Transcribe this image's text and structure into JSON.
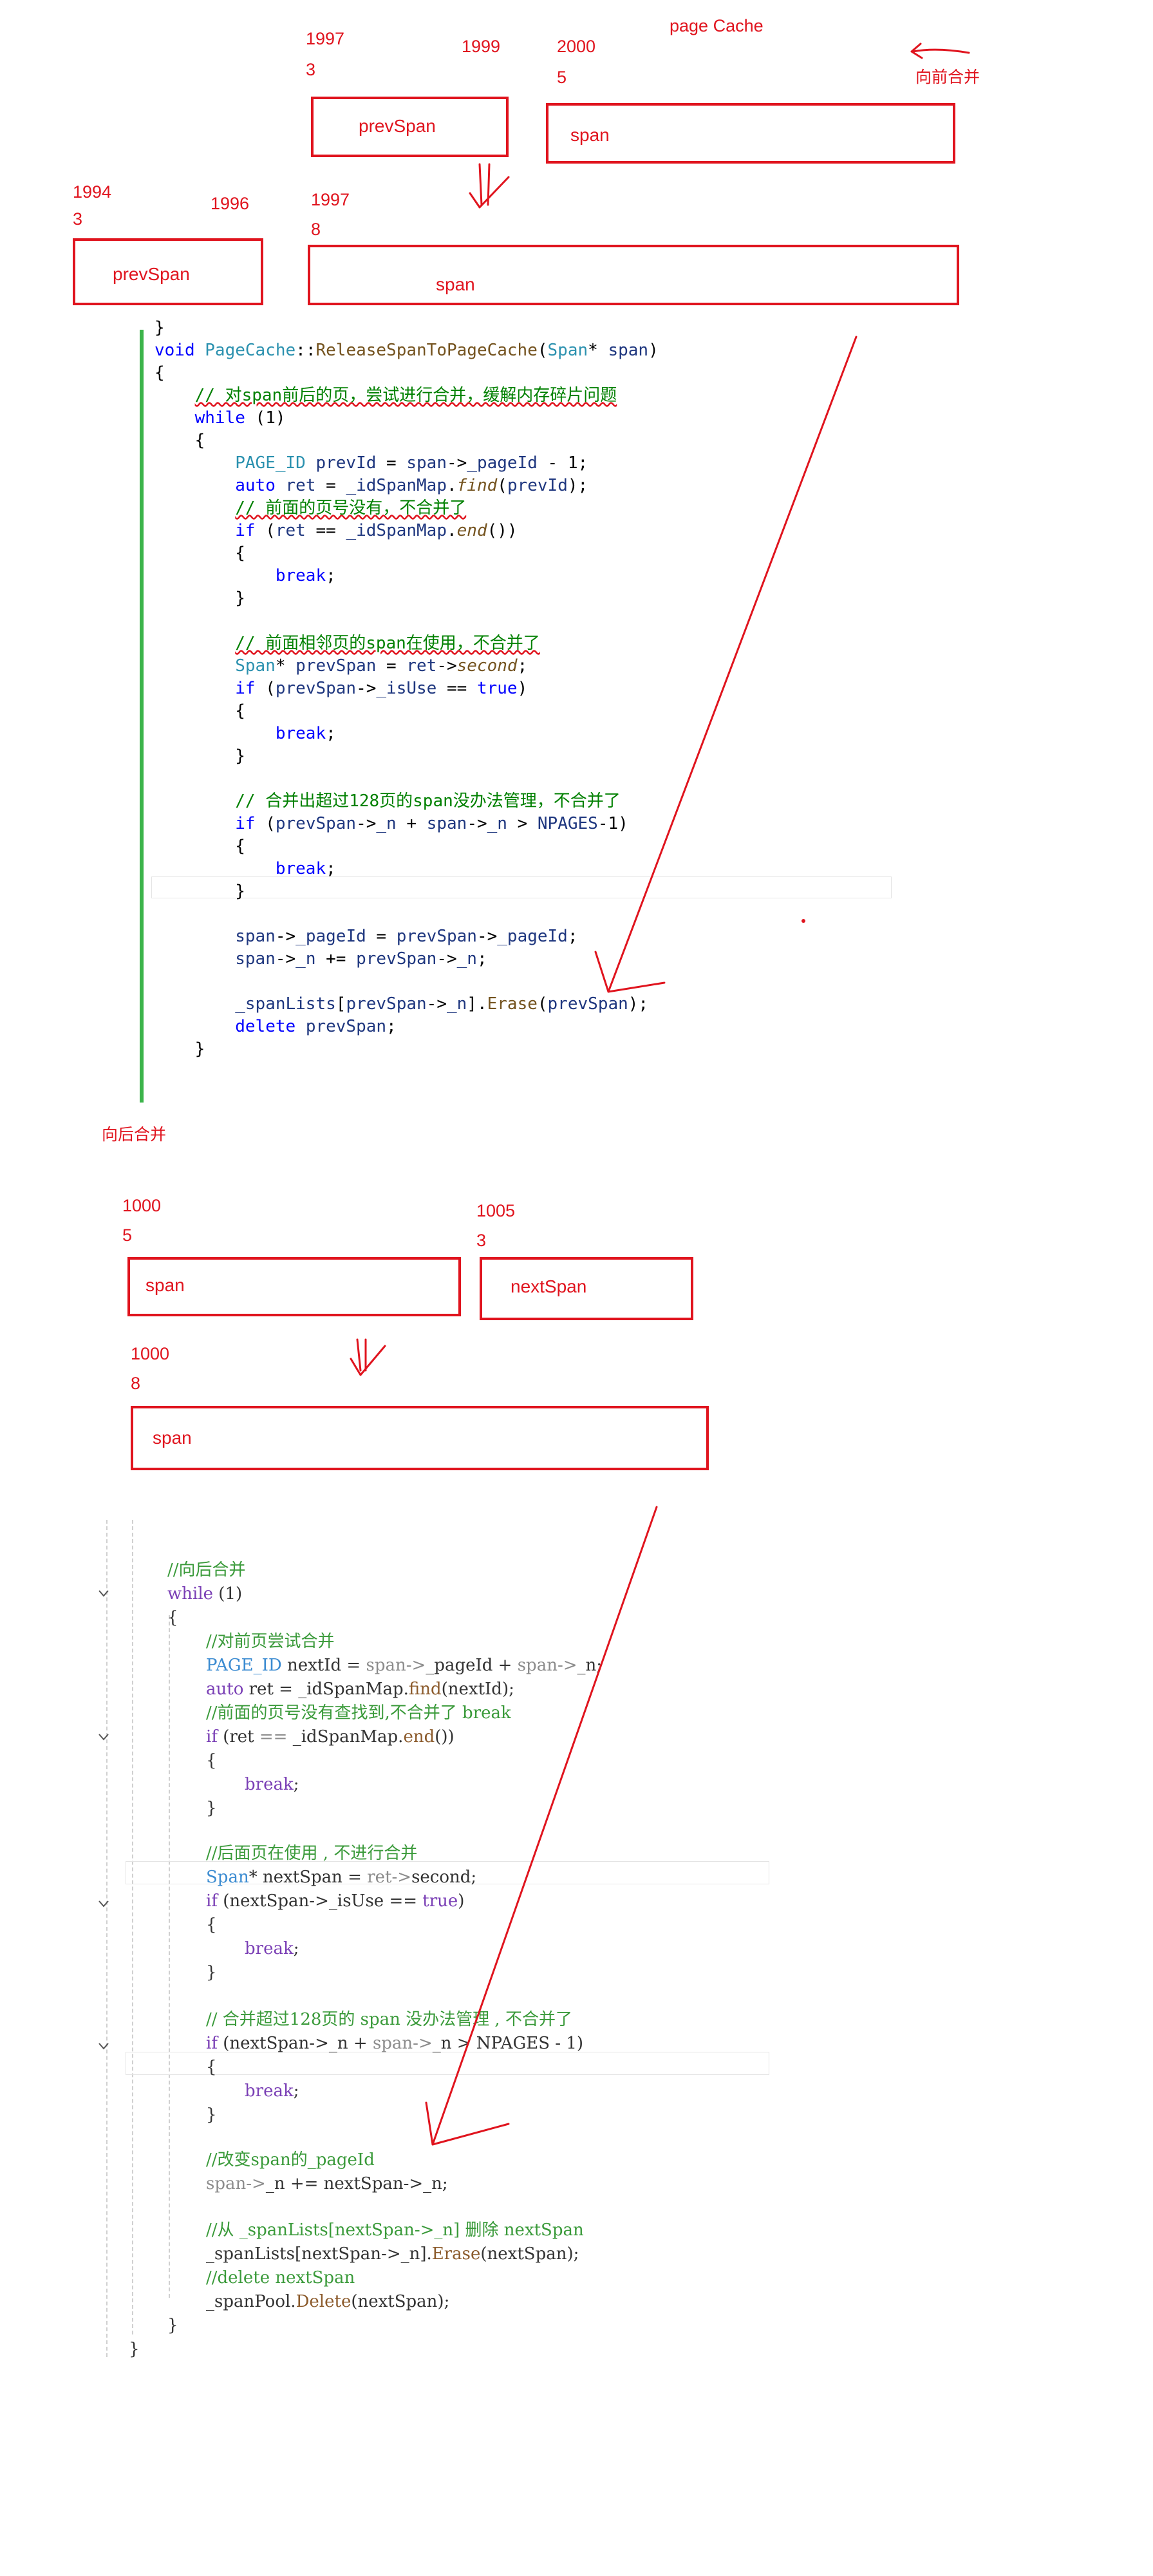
{
  "annotations": {
    "page_cache": "page Cache",
    "merge_forward": "向前合并",
    "merge_backward": "向后合并",
    "n_19973": [
      "1997",
      "3"
    ],
    "n_1999": "1999",
    "n_20005": [
      "2000",
      "5"
    ],
    "n_19943": [
      "1994",
      "3"
    ],
    "n_1996": "1996",
    "n_19978": [
      "1997",
      "8"
    ],
    "n_10005": [
      "1000",
      "5"
    ],
    "n_10053": [
      "1005",
      "3"
    ],
    "n_10008": [
      "1000",
      "8"
    ]
  },
  "boxes": {
    "prevspan_top": "prevSpan",
    "span_top": "span",
    "prevspan_mid": "prevSpan",
    "span_merged_1": "span",
    "span_back": "span",
    "nextspan": "nextSpan",
    "span_merged_2": "span"
  },
  "code_forward": [
    "}",
    "void PageCache::ReleaseSpanToPageCache(Span* span)",
    "{",
    "    // 对span前后的页，尝试进行合并，缓解内存碎片问题",
    "    while (1)",
    "    {",
    "        PAGE_ID prevId = span->_pageId - 1;",
    "        auto ret = _idSpanMap.find(prevId);",
    "        // 前面的页号没有，不合并了",
    "        if (ret == _idSpanMap.end())",
    "        {",
    "            break;",
    "        }",
    "",
    "        // 前面相邻页的span在使用，不合并了",
    "        Span* prevSpan = ret->second;",
    "        if (prevSpan->_isUse == true)",
    "        {",
    "            break;",
    "        }",
    "",
    "        // 合并出超过128页的span没办法管理，不合并了",
    "        if (prevSpan->_n + span->_n > NPAGES-1)",
    "        {",
    "            break;",
    "        }",
    "",
    "        span->_pageId = prevSpan->_pageId;",
    "        span->_n += prevSpan->_n;",
    "",
    "        _spanLists[prevSpan->_n].Erase(prevSpan);",
    "        delete prevSpan;",
    "    }"
  ],
  "code_backward": [
    "    }",
    "    //向后合并",
    "    while (1)",
    "    {",
    "        //对前页尝试合并",
    "        PAGE_ID nextId = span->_pageId + span->_n;",
    "        auto ret = _idSpanMap.find(nextId);",
    "        //前面的页号没有查找到,不合并了 break",
    "        if (ret == _idSpanMap.end())",
    "        {",
    "            break;",
    "        }",
    "",
    "        //后面页在使用 , 不进行合并",
    "        Span* nextSpan = ret->second;",
    "        if (nextSpan->_isUse == true)",
    "        {",
    "            break;",
    "        }",
    "",
    "        // 合并超过128页的 span 没办法管理 , 不合并了",
    "        if (nextSpan->_n + span->_n > NPAGES - 1)",
    "        {",
    "            break;",
    "        }",
    "",
    "        //改变span的_pageId",
    "        span->_n += nextSpan->_n;",
    "",
    "        //从 _spanLists[nextSpan->_n] 删除 nextSpan",
    "        _spanLists[nextSpan->_n].Erase(nextSpan);",
    "        //delete nextSpan",
    "        _spanPool.Delete(nextSpan);",
    "    }",
    "}"
  ]
}
